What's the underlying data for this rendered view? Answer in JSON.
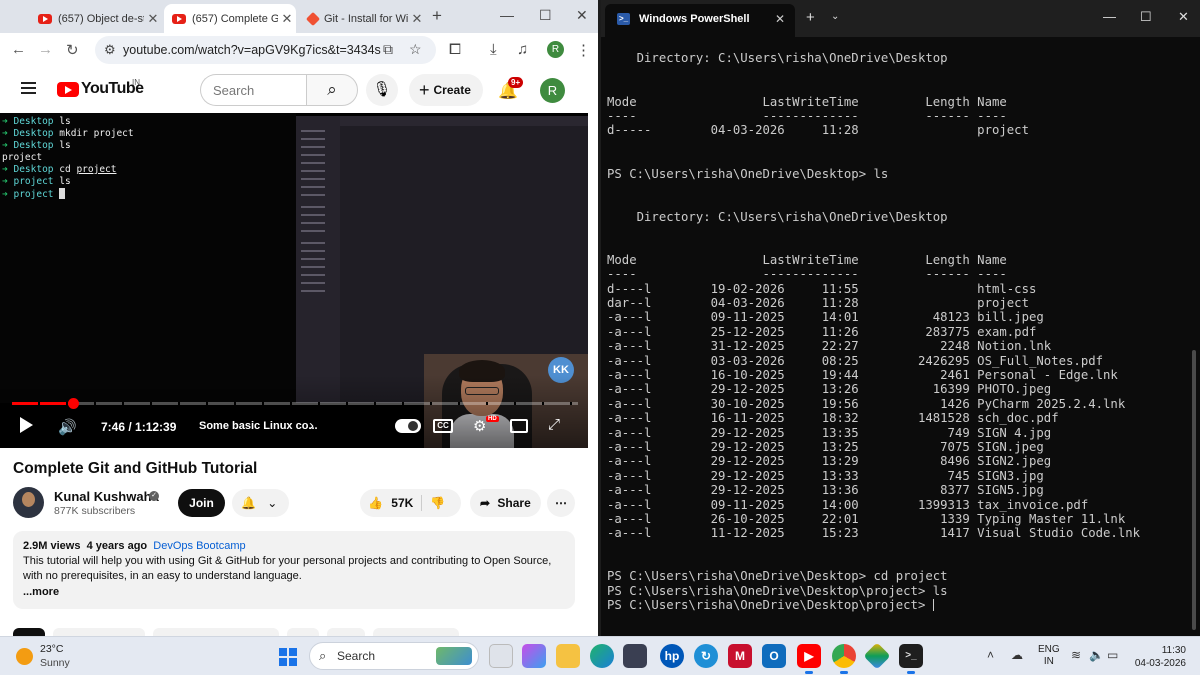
{
  "chrome": {
    "tabs": [
      {
        "title": "(657) Object de-st",
        "active": false
      },
      {
        "title": "(657) Complete Gi",
        "active": true
      },
      {
        "title": "Git - Install for Wi",
        "active": false
      }
    ],
    "new_tab": "+",
    "url": "youtube.com/watch?v=apGV9Kg7ics&t=3434s",
    "profile_initial": "R"
  },
  "youtube": {
    "logo_text": "YouTube",
    "country_code": "IN",
    "search_placeholder": "Search",
    "create_label": "Create",
    "notification_count": "9+",
    "avatar_initial": "R"
  },
  "video_terminal": {
    "lines": [
      {
        "prompt": "➜",
        "dir": "Desktop",
        "cmd": "ls"
      },
      {
        "prompt": "➜",
        "dir": "Desktop",
        "cmd": "mkdir project"
      },
      {
        "prompt": "➜",
        "dir": "Desktop",
        "cmd": "ls"
      },
      {
        "output": "project"
      },
      {
        "prompt": "➜",
        "dir": "Desktop",
        "cmd": "cd",
        "arg": "project"
      },
      {
        "prompt": "➜",
        "dir": "project",
        "cmd": "ls"
      },
      {
        "prompt": "➜",
        "dir": "project",
        "cmd": ""
      }
    ],
    "facecam_logo": "KK"
  },
  "player": {
    "time": "7:46 / 1:12:39",
    "chapter": "Some basic Linux co...",
    "progress_fraction": 0.107,
    "hd_badge": "HD",
    "cc_label": "CC"
  },
  "video": {
    "title": "Complete Git and GitHub Tutorial",
    "channel": "Kunal Kushwaha",
    "subscribers": "877K subscribers",
    "join_label": "Join",
    "likes": "57K",
    "share_label": "Share",
    "views": "2.9M views",
    "age": "4 years ago",
    "hashtag": "DevOps Bootcamp",
    "description": "This tutorial will help you with using Git & GitHub for your personal projects and contributing to Open Source, with no prerequisites, in an easy to understand language.",
    "more_label": "...more"
  },
  "terminal": {
    "tab_title": "Windows PowerShell",
    "lines": [
      "",
      "    Directory: C:\\Users\\risha\\OneDrive\\Desktop",
      "",
      "",
      "Mode                 LastWriteTime         Length Name",
      "----                 -------------         ------ ----",
      "d-----        04-03-2026     11:28                project",
      "",
      "",
      "PS C:\\Users\\risha\\OneDrive\\Desktop> ls",
      "",
      "",
      "    Directory: C:\\Users\\risha\\OneDrive\\Desktop",
      "",
      "",
      "Mode                 LastWriteTime         Length Name",
      "----                 -------------         ------ ----",
      "d----l        19-02-2026     11:55                html-css",
      "dar--l        04-03-2026     11:28                project",
      "-a---l        09-11-2025     14:01          48123 bill.jpeg",
      "-a---l        25-12-2025     11:26         283775 exam.pdf",
      "-a---l        31-12-2025     22:27           2248 Notion.lnk",
      "-a---l        03-03-2026     08:25        2426295 OS_Full_Notes.pdf",
      "-a---l        16-10-2025     19:44           2461 Personal - Edge.lnk",
      "-a---l        29-12-2025     13:26          16399 PHOTO.jpeg",
      "-a---l        30-10-2025     19:56           1426 PyCharm 2025.2.4.lnk",
      "-a---l        16-11-2025     18:32        1481528 sch_doc.pdf",
      "-a---l        29-12-2025     13:35            749 SIGN 4.jpg",
      "-a---l        29-12-2025     13:25           7075 SIGN.jpeg",
      "-a---l        29-12-2025     13:29           8496 SIGN2.jpeg",
      "-a---l        29-12-2025     13:33            745 SIGN3.jpg",
      "-a---l        29-12-2025     13:36           8377 SIGN5.jpg",
      "-a---l        09-11-2025     14:00        1399313 tax_invoice.pdf",
      "-a---l        26-10-2025     22:01           1339 Typing Master 11.lnk",
      "-a---l        11-12-2025     15:23           1417 Visual Studio Code.lnk",
      "",
      "",
      "PS C:\\Users\\risha\\OneDrive\\Desktop> cd project",
      "PS C:\\Users\\risha\\OneDrive\\Desktop\\project> ls",
      "PS C:\\Users\\risha\\OneDrive\\Desktop\\project> "
    ]
  },
  "taskbar": {
    "weather_temp": "23°C",
    "weather_condition": "Sunny",
    "search_placeholder": "Search",
    "language": "ENG",
    "region": "IN",
    "time": "11:30",
    "date": "04-03-2026"
  }
}
